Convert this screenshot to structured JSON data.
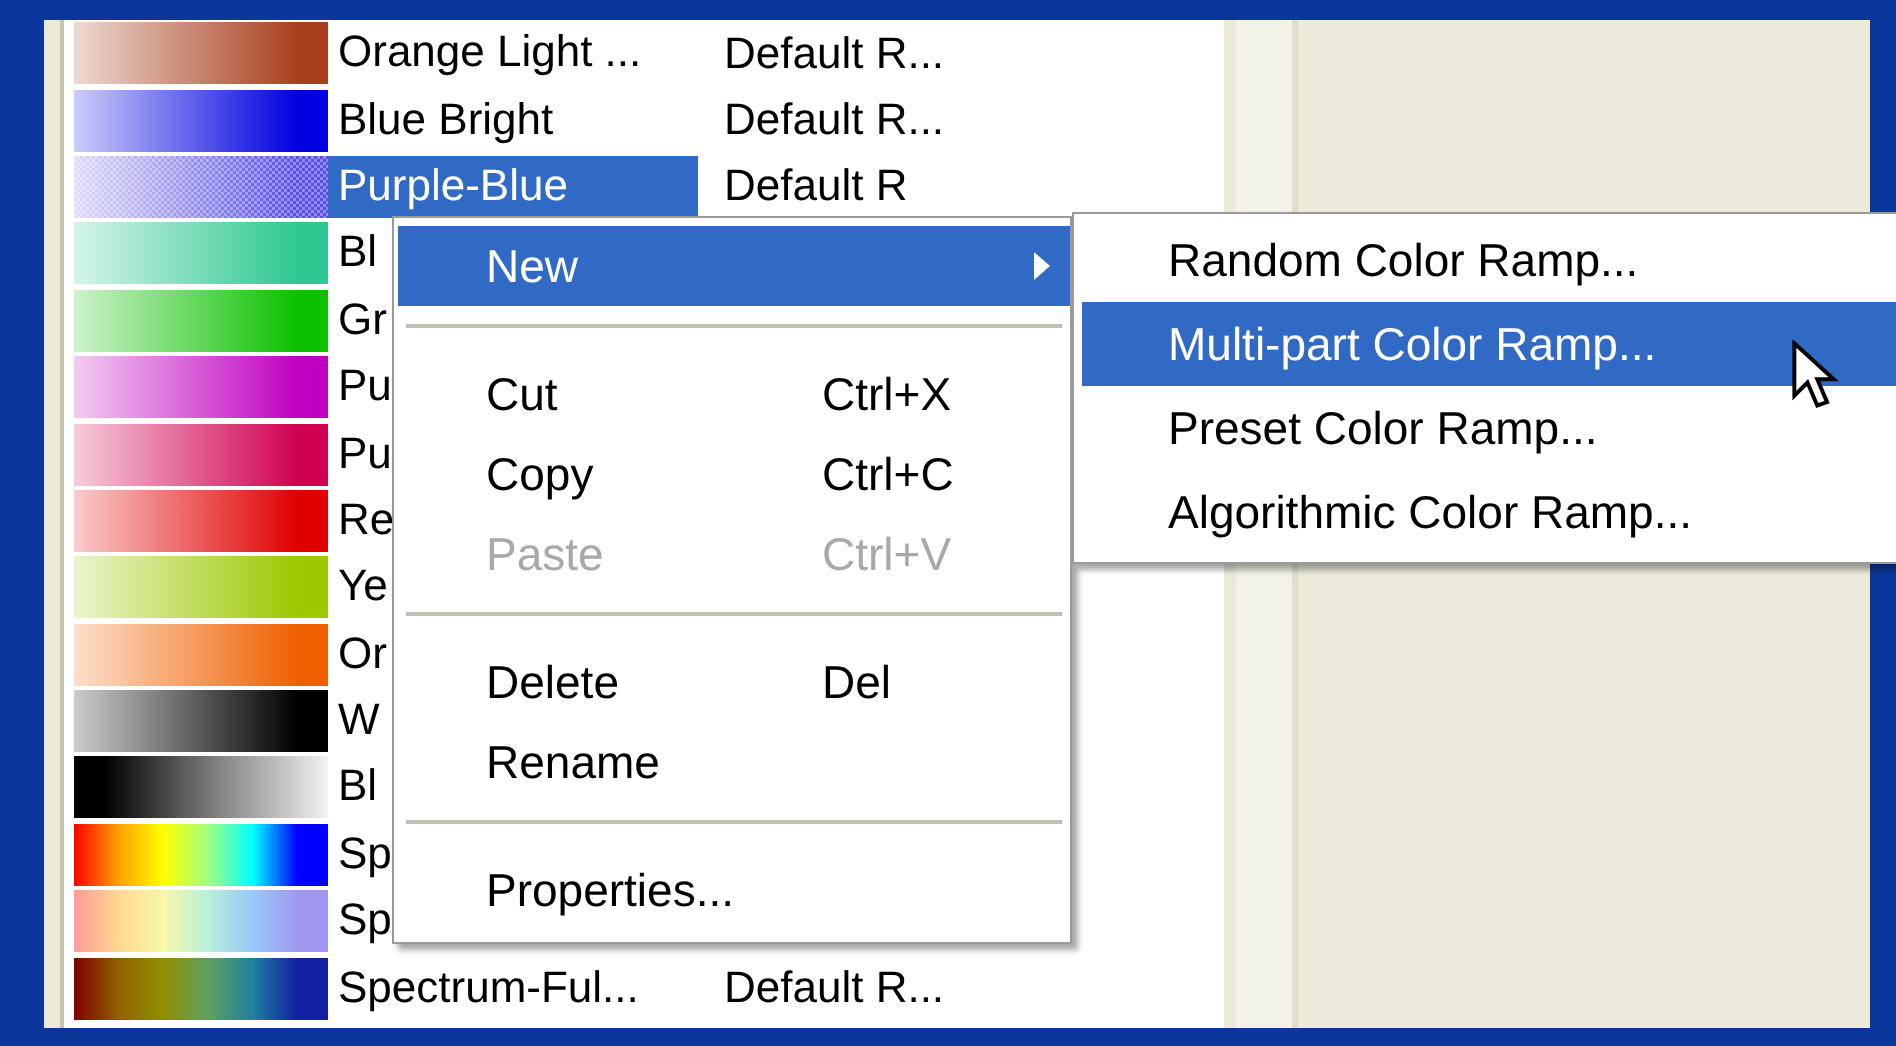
{
  "ramps": [
    {
      "name": "Orange Light ...",
      "category": "Default R...",
      "selected": false,
      "kind": "ascending",
      "color": "#a8401e"
    },
    {
      "name": "Blue Bright",
      "category": "Default R...",
      "selected": false,
      "kind": "ascending",
      "color": "#0000e0"
    },
    {
      "name": "Purple-Blue",
      "category": "Default R",
      "selected": true,
      "kind": "ascending",
      "color": "#5a4ee8"
    },
    {
      "name": "Bl",
      "selected": false,
      "kind": "ascending",
      "color": "#2ec890"
    },
    {
      "name": "Gr",
      "selected": false,
      "kind": "ascending",
      "color": "#0cc000"
    },
    {
      "name": "Pu",
      "selected": false,
      "kind": "ascending",
      "color": "#c000c0"
    },
    {
      "name": "Pu",
      "selected": false,
      "kind": "ascending",
      "color": "#d00050"
    },
    {
      "name": "Re",
      "selected": false,
      "kind": "ascending",
      "color": "#e00000"
    },
    {
      "name": "Ye",
      "selected": false,
      "kind": "ascending",
      "color": "#9cc800"
    },
    {
      "name": "Or",
      "selected": false,
      "kind": "ascending",
      "color": "#f06000"
    },
    {
      "name": "W",
      "selected": false,
      "kind": "ascending",
      "color": "#000000"
    },
    {
      "name": "Bl",
      "selected": false,
      "kind": "descending",
      "color": "#000000"
    },
    {
      "name": "Sp",
      "selected": false,
      "kind": "spectrum",
      "color": "#0000ff"
    },
    {
      "name": "Sp",
      "selected": false,
      "kind": "pastel",
      "color": "#a098f0"
    },
    {
      "name": "Spectrum-Ful...",
      "category": "Default R...",
      "selected": false,
      "kind": "earth",
      "color": "#1020a0"
    }
  ],
  "context_menu": {
    "items": [
      {
        "kind": "item",
        "label": "New",
        "selected": true,
        "submenu": true,
        "disabled": false
      },
      {
        "kind": "separator"
      },
      {
        "kind": "item",
        "label": "Cut",
        "shortcut": "Ctrl+X",
        "selected": false,
        "disabled": false
      },
      {
        "kind": "item",
        "label": "Copy",
        "shortcut": "Ctrl+C",
        "selected": false,
        "disabled": false
      },
      {
        "kind": "item",
        "label": "Paste",
        "shortcut": "Ctrl+V",
        "selected": false,
        "disabled": true
      },
      {
        "kind": "separator"
      },
      {
        "kind": "item",
        "label": "Delete",
        "shortcut": "Del",
        "selected": false,
        "disabled": false
      },
      {
        "kind": "item",
        "label": "Rename",
        "selected": false,
        "disabled": false
      },
      {
        "kind": "separator"
      },
      {
        "kind": "item",
        "label": "Properties...",
        "selected": false,
        "disabled": false
      }
    ]
  },
  "submenu": {
    "items": [
      {
        "label": "Random Color Ramp...",
        "selected": false
      },
      {
        "label": "Multi-part Color Ramp...",
        "selected": true
      },
      {
        "label": "Preset Color Ramp...",
        "selected": false
      },
      {
        "label": "Algorithmic Color Ramp...",
        "selected": false
      }
    ]
  }
}
